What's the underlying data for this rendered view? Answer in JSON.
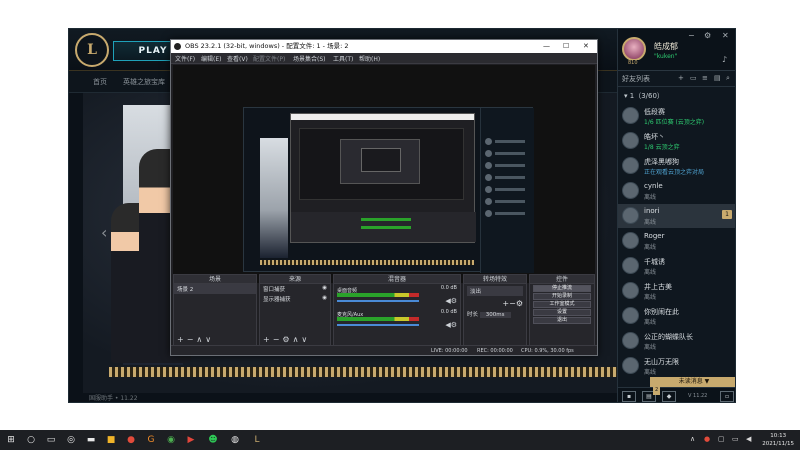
{
  "lol": {
    "logo": "L",
    "play": "PLAY",
    "subnav": [
      "首页",
      "英雄之旅宝库"
    ],
    "bottom_text": "国服助手 • 11.22",
    "window_controls": [
      "−",
      "⚙",
      "✕"
    ]
  },
  "friends": {
    "profile_name": "皓成郁",
    "profile_status": "\"kuken\"",
    "level": "810",
    "title": "好友列表",
    "group": "1（3/60）",
    "items": [
      {
        "name": "低段赛",
        "status": "1/6 匹位赛 (云顶之弈)",
        "status_color": "#2ecc71"
      },
      {
        "name": "皓坏丶",
        "status": "1/8 云顶之弈",
        "status_color": "#2ecc71"
      },
      {
        "name": "虎泽黑嘟狗",
        "status": "正在观看云顶之弈对局",
        "status_color": "#4fa3d1"
      },
      {
        "name": "cynle",
        "status": "离线",
        "status_color": "#8a9299"
      },
      {
        "name": "inori",
        "status": "离线",
        "status_color": "#8a9299",
        "badge": "1"
      },
      {
        "name": "Roger",
        "status": "离线",
        "status_color": "#8a9299"
      },
      {
        "name": "千城诱",
        "status": "离线",
        "status_color": "#8a9299"
      },
      {
        "name": "井上古美",
        "status": "离线",
        "status_color": "#8a9299"
      },
      {
        "name": "你别闹在此",
        "status": "离线",
        "status_color": "#8a9299"
      },
      {
        "name": "公正的蝴蝶队长",
        "status": "离线",
        "status_color": "#8a9299"
      },
      {
        "name": "无山万无限",
        "status": "离线",
        "status_color": "#8a9299"
      }
    ],
    "chat_bar": "未读消息 ▼",
    "footer_badge": "2",
    "footer_version": "V 11.22"
  },
  "obs": {
    "title": "OBS 23.2.1 (32-bit, windows) - 配置文件: 1 - 场景: 2",
    "window_controls": [
      "—",
      "☐",
      "✕"
    ],
    "menu": [
      "文件(F)",
      "编辑(E)",
      "查看(V)",
      "配置文件(P)",
      "场景集合(S)",
      "工具(T)",
      "帮助(H)"
    ],
    "docks": {
      "scenes": {
        "title": "场景",
        "items": [
          "场景 2"
        ]
      },
      "sources": {
        "title": "来源",
        "items": [
          "窗口捕获",
          "显示器捕获"
        ]
      },
      "mixer": {
        "title": "混音器",
        "rows": [
          "桌面音频",
          "麦克风/Aux"
        ],
        "values": [
          "0.0 dB",
          "0.0 dB"
        ]
      },
      "transitions": {
        "title": "转场特效",
        "type": "淡出",
        "duration_label": "时长",
        "duration": "300ms"
      },
      "controls": {
        "title": "控件",
        "buttons": [
          "停止推流",
          "开始录制",
          "工作室模式",
          "设置",
          "退出"
        ]
      }
    },
    "status": {
      "live": "LIVE: 00:00:00",
      "rec": "REC: 00:00:00",
      "cpu": "CPU: 0.9%, 30.00 fps"
    }
  },
  "taskbar": {
    "time": "10:13",
    "date": "2021/11/15"
  }
}
